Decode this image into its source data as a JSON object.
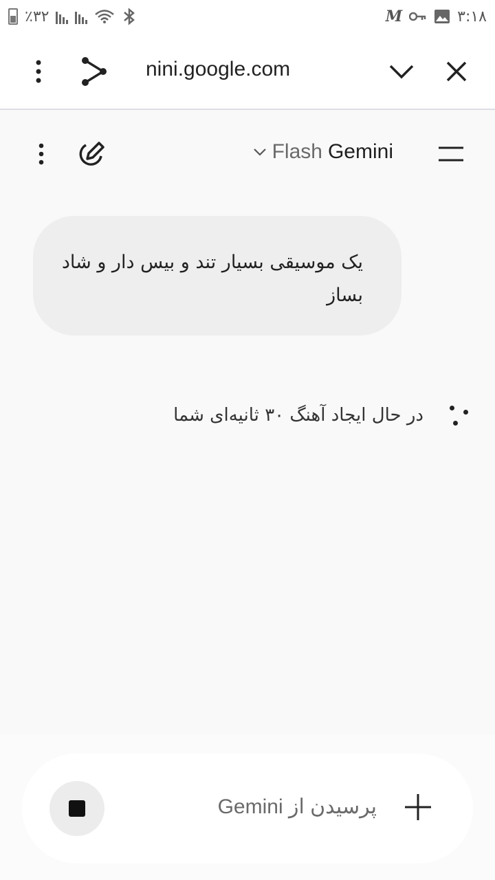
{
  "status_bar": {
    "battery_percent": "٪۳۲",
    "time": "۳:۱۸"
  },
  "browser": {
    "url": "nini.google.com"
  },
  "header": {
    "model": "Flash",
    "app_name": "Gemini"
  },
  "conversation": {
    "user_message": "یک موسیقی بسیار تند و بیس دار و شاد بساز",
    "status_text": "در حال ایجاد آهنگ ۳۰ ثانیه‌ای شما"
  },
  "composer": {
    "placeholder": "پرسیدن از Gemini"
  },
  "icons": {
    "menu": "kebab-menu-icon",
    "share": "share-icon",
    "collapse": "chevron-down-icon",
    "close": "close-icon",
    "edit": "new-chat-icon",
    "drawer": "hamburger-icon",
    "stop": "stop-icon",
    "add": "plus-icon"
  }
}
